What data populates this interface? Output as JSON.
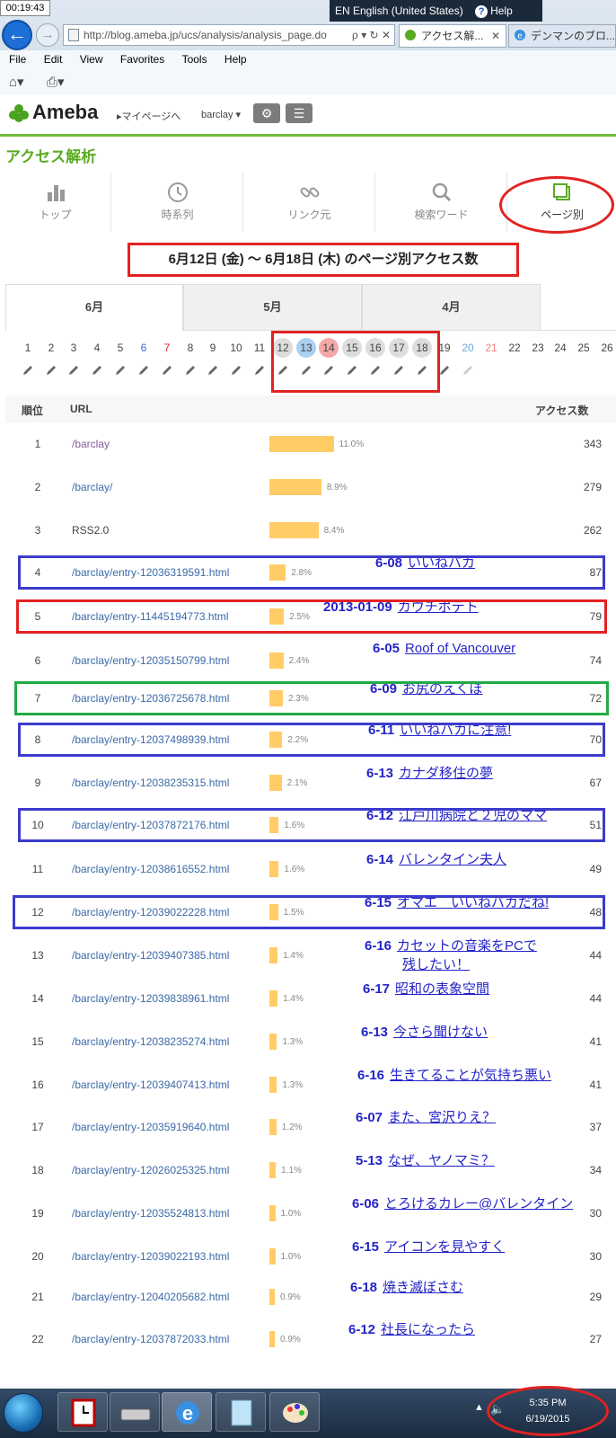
{
  "browser": {
    "timer": "00:19:43",
    "lang": "EN English (United States)",
    "help": "Help",
    "address": "http://blog.ameba.jp/ucs/analysis/analysis_page.do",
    "tabs": [
      {
        "label": "アクセス解..."
      },
      {
        "label": "デンマンのブロ..."
      }
    ],
    "menu": [
      "File",
      "Edit",
      "View",
      "Favorites",
      "Tools",
      "Help"
    ]
  },
  "header": {
    "logo": "Ameba",
    "mypage": "▸マイページへ",
    "user": "barclay ▾"
  },
  "page_title": "アクセス解析",
  "nav": [
    {
      "label": "トップ"
    },
    {
      "label": "時系列"
    },
    {
      "label": "リンク元"
    },
    {
      "label": "検索ワード"
    },
    {
      "label": "ページ別"
    }
  ],
  "period": "6月12日 (金) 〜 6月18日 (木) のページ別アクセス数",
  "months": [
    "6月",
    "5月",
    "4月"
  ],
  "days": [
    "1",
    "2",
    "3",
    "4",
    "5",
    "6",
    "7",
    "8",
    "9",
    "10",
    "11",
    "12",
    "13",
    "14",
    "15",
    "16",
    "17",
    "18",
    "19",
    "20",
    "21",
    "22",
    "23",
    "24",
    "25",
    "26"
  ],
  "table": {
    "headers": {
      "rank": "順位",
      "url": "URL",
      "count": "アクセス数"
    },
    "rows": [
      {
        "rank": "1",
        "url": "/barclay",
        "pct": "11.0%",
        "share": 11.0,
        "count": "343"
      },
      {
        "rank": "2",
        "url": "/barclay/",
        "pct": "8.9%",
        "share": 8.9,
        "count": "279"
      },
      {
        "rank": "3",
        "url": "RSS2.0",
        "pct": "8.4%",
        "share": 8.4,
        "count": "262"
      },
      {
        "rank": "4",
        "url": "/barclay/entry-12036319591.html",
        "pct": "2.8%",
        "share": 2.8,
        "count": "87",
        "note_date": "6-08",
        "note_title": "いいねバカ"
      },
      {
        "rank": "5",
        "url": "/barclay/entry-11445194773.html",
        "pct": "2.5%",
        "share": 2.5,
        "count": "79",
        "note_date": "2013-01-09",
        "note_title": "カウチポテト"
      },
      {
        "rank": "6",
        "url": "/barclay/entry-12035150799.html",
        "pct": "2.4%",
        "share": 2.4,
        "count": "74",
        "note_date": "6-05",
        "note_title": "Roof of Vancouver"
      },
      {
        "rank": "7",
        "url": "/barclay/entry-12036725678.html",
        "pct": "2.3%",
        "share": 2.3,
        "count": "72",
        "note_date": "6-09",
        "note_title": "お尻のえくぼ"
      },
      {
        "rank": "8",
        "url": "/barclay/entry-12037498939.html",
        "pct": "2.2%",
        "share": 2.2,
        "count": "70",
        "note_date": "6-11",
        "note_title": "いいねバカに注意!"
      },
      {
        "rank": "9",
        "url": "/barclay/entry-12038235315.html",
        "pct": "2.1%",
        "share": 2.1,
        "count": "67",
        "note_date": "6-13",
        "note_title": "カナダ移住の夢"
      },
      {
        "rank": "10",
        "url": "/barclay/entry-12037872176.html",
        "pct": "1.6%",
        "share": 1.6,
        "count": "51",
        "note_date": "6-12",
        "note_title": "江戸川病院と２児のママ"
      },
      {
        "rank": "11",
        "url": "/barclay/entry-12038616552.html",
        "pct": "1.6%",
        "share": 1.6,
        "count": "49",
        "note_date": "6-14",
        "note_title": "バレンタイン夫人"
      },
      {
        "rank": "12",
        "url": "/barclay/entry-12039022228.html",
        "pct": "1.5%",
        "share": 1.5,
        "count": "48",
        "note_date": "6-15",
        "note_title": "オマエ　いいねバカだね!"
      },
      {
        "rank": "13",
        "url": "/barclay/entry-12039407385.html",
        "pct": "1.4%",
        "share": 1.4,
        "count": "44",
        "note_date": "6-16",
        "note_title": "カセットの音楽をPCで",
        "note_title2": "残したい！"
      },
      {
        "rank": "14",
        "url": "/barclay/entry-12039838961.html",
        "pct": "1.4%",
        "share": 1.4,
        "count": "44",
        "note_date": "6-17",
        "note_title": "昭和の表象空間"
      },
      {
        "rank": "15",
        "url": "/barclay/entry-12038235274.html",
        "pct": "1.3%",
        "share": 1.3,
        "count": "41",
        "note_date": "6-13",
        "note_title": "今さら聞けない"
      },
      {
        "rank": "16",
        "url": "/barclay/entry-12039407413.html",
        "pct": "1.3%",
        "share": 1.3,
        "count": "41",
        "note_date": "6-16",
        "note_title": "生きてることが気持ち悪い"
      },
      {
        "rank": "17",
        "url": "/barclay/entry-12035919640.html",
        "pct": "1.2%",
        "share": 1.2,
        "count": "37",
        "note_date": "6-07",
        "note_title": "また、宮沢りえ？"
      },
      {
        "rank": "18",
        "url": "/barclay/entry-12026025325.html",
        "pct": "1.1%",
        "share": 1.1,
        "count": "34",
        "note_date": "5-13",
        "note_title": "なぜ、ヤノマミ？"
      },
      {
        "rank": "19",
        "url": "/barclay/entry-12035524813.html",
        "pct": "1.0%",
        "share": 1.0,
        "count": "30",
        "note_date": "6-06",
        "note_title": "とろけるカレー@バレンタイン"
      },
      {
        "rank": "20",
        "url": "/barclay/entry-12039022193.html",
        "pct": "1.0%",
        "share": 1.0,
        "count": "30",
        "note_date": "6-15",
        "note_title": "アイコンを見やすく"
      },
      {
        "rank": "21",
        "url": "/barclay/entry-12040205682.html",
        "pct": "0.9%",
        "share": 0.9,
        "count": "29",
        "note_date": "6-18",
        "note_title": "焼き滅ぼさむ"
      },
      {
        "rank": "22",
        "url": "/barclay/entry-12037872033.html",
        "pct": "0.9%",
        "share": 0.9,
        "count": "27",
        "note_date": "6-12",
        "note_title": "社長になったら"
      }
    ]
  },
  "taskbar": {
    "time": "5:35 PM",
    "date": "6/19/2015"
  },
  "colors": {
    "accent": "#5aab23",
    "bar": "#ffcc66",
    "link": "#3b6aa8",
    "annotation": "#2424c8",
    "red": "#e22222"
  }
}
